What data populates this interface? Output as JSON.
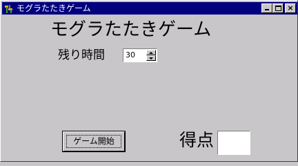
{
  "window": {
    "title": "モグラたたきゲーム",
    "title_bar_color": "#00007f",
    "background_color": "#c8c6c8"
  },
  "icons": {
    "app": "hammer-icon",
    "minimize": "minimize-icon",
    "maximize": "maximize-icon",
    "close": "close-icon"
  },
  "controls": {
    "close_glyph": "×"
  },
  "main": {
    "heading": "モグラたたきゲーム",
    "time_label": "残り時間",
    "time_value": "30",
    "start_button_label": "ゲーム開始",
    "score_label": "得点",
    "score_value": ""
  }
}
